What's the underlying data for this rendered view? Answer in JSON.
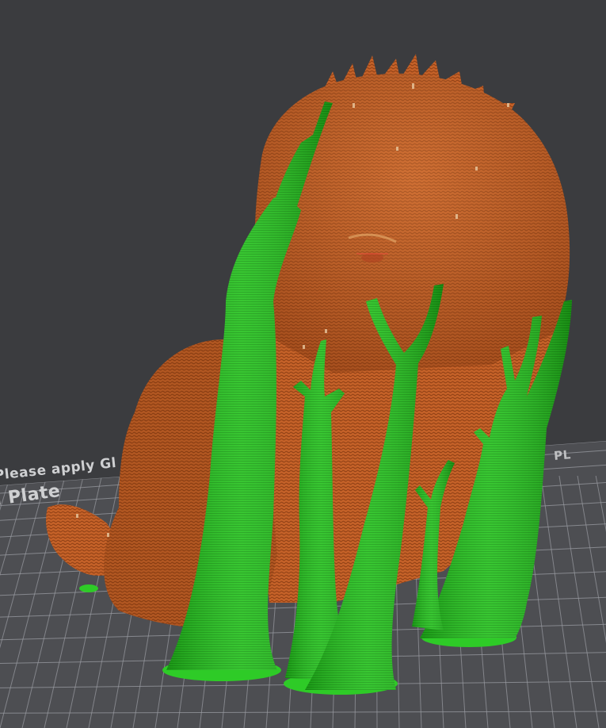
{
  "viewport": {
    "background": "#3b3c3f"
  },
  "plate": {
    "warning_text": "Please apply Gl",
    "name_text": "l Plate",
    "name_text_right": "PL",
    "bed_color": "#4d4e52",
    "grid_color": "#9a9ca2"
  },
  "model": {
    "name": "dog model",
    "color": "#c8642a",
    "highlight_color": "#e9a86b"
  },
  "supports": {
    "type": "tree supports",
    "color": "#22b81d",
    "highlight_color": "#5fe85a"
  }
}
